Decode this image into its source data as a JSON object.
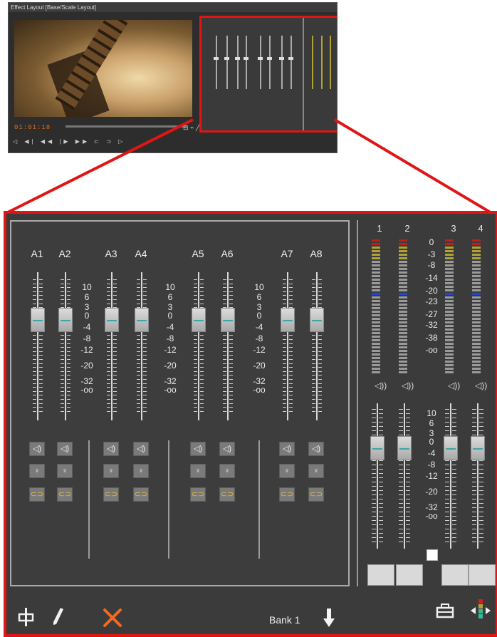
{
  "thumbnail": {
    "title": "Effect Layout  [Base/Scale Layout]",
    "timecode": "01:01:18",
    "transport_glyphs": "◁  ◀|  ◀◀  |▶  ▶▶  ⊏  ⊐  ▷"
  },
  "mixer": {
    "channels": [
      {
        "label": "A1"
      },
      {
        "label": "A2"
      },
      {
        "label": "A3"
      },
      {
        "label": "A4"
      },
      {
        "label": "A5"
      },
      {
        "label": "A6"
      },
      {
        "label": "A7"
      },
      {
        "label": "A8"
      }
    ],
    "fader_scale": [
      "10",
      "6",
      "3",
      "0",
      "-4",
      "-8",
      "-12",
      "-20",
      "-32",
      "-oo"
    ],
    "meters": {
      "labels": [
        "1",
        "2",
        "3",
        "4"
      ],
      "scale": [
        "0",
        "-3",
        "-8",
        "-14",
        "-20",
        "-23",
        "-27",
        "-32",
        "-38",
        "-oo"
      ]
    },
    "output_fader_scale": [
      "10",
      "6",
      "3",
      "0",
      "-4",
      "-8",
      "-12",
      "-20",
      "-32",
      "-oo"
    ],
    "bank_label": "Bank 1",
    "colors": {
      "frame": "#e01515",
      "panel": "#3b3b3b",
      "meter_red": "#b42222",
      "meter_yellow": "#b0a235",
      "meter_blue": "#2244dd",
      "knob_line": "#3fa6a6",
      "delete_x": "#f26a21"
    },
    "icons": {
      "mute": "speaker-icon",
      "solo": "microphone-icon",
      "link": "link-icon",
      "meter_speaker": "speaker-icon",
      "toolbar": [
        "fader-tool-icon",
        "pencil-icon",
        "delete-x-icon",
        "down-arrow-icon",
        "toolbox-icon",
        "level-arrows-icon"
      ]
    }
  }
}
